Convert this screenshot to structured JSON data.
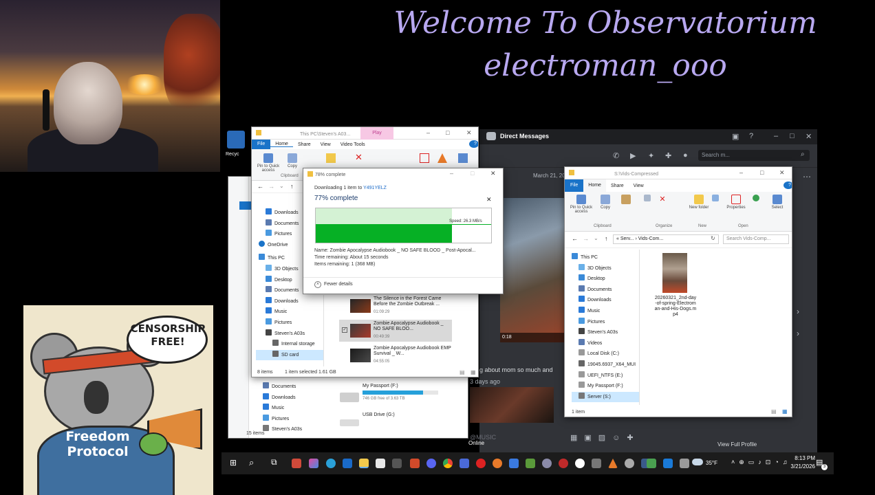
{
  "stream": {
    "line1": "Welcome To Observatorium",
    "line2": "electroman_ooo"
  },
  "koala": {
    "bubble_line1": "CENSORSHIP",
    "bubble_line2": "FREE!",
    "hoodie_line1": "Freedom",
    "hoodie_line2": "Protocol"
  },
  "discord": {
    "title": "Direct Messages",
    "search_placeholder": "Search m...",
    "date": "March 21, 2026",
    "video_time": "0:18",
    "message": "g about mom so  much and",
    "ago": "3 days ago",
    "input_label": "@MUSIC",
    "view_profile": "View Full Profile",
    "online": "Online"
  },
  "explorer_left": {
    "title": "This PC\\Steven's A03...",
    "context_tab": "Play",
    "tabs": [
      "File",
      "Home",
      "Share",
      "View",
      "Video Tools"
    ],
    "ribbon": {
      "pin": "Pin to Quick access",
      "copy": "Copy",
      "clipboard": "Clipboard"
    },
    "nav": [
      "Downloads",
      "Documents",
      "Pictures",
      "OneDrive",
      "This PC",
      "3D Objects",
      "Desktop",
      "Documents",
      "Downloads",
      "Music",
      "Pictures",
      "Steven's A03s",
      "Internal storage",
      "SD card"
    ],
    "files": [
      {
        "name": "The Silence in the Forest Came Before the Zombie Outbreak ...",
        "duration": "01:09:29",
        "selected": false
      },
      {
        "name": "Zombie Apocalypse Audiobook _ NO SAFE BLOO...",
        "duration": "00:49:39",
        "selected": true
      },
      {
        "name": "Zombie Apocalypse Audiobook EMP Survival _ W...",
        "duration": "04:55:05",
        "selected": false
      }
    ],
    "status_items": "8 items",
    "status_selected": "1 item selected  1.61 GB"
  },
  "explorer_back": {
    "nav": [
      "Documents",
      "Downloads",
      "Music",
      "Pictures",
      "Steven's A03s"
    ],
    "drives": [
      {
        "name": "My Passport (F:)",
        "free": "746 GB free of 3.63 TB",
        "used": 0.8
      },
      {
        "name": "USB Drive (G:)",
        "free": "",
        "used": 0
      }
    ],
    "status": "15 items"
  },
  "download": {
    "title": "78% complete",
    "downloading_prefix": "Downloading 1 item to ",
    "destination": "Y491YELZ",
    "percent_text": "77% complete",
    "speed": "Speed: 26.3 MB/s",
    "progress": 0.77,
    "name": "Name: Zombie Apocalypse Audiobook _ NO SAFE BLOOD _ Post-Apocal...",
    "time_remaining": "Time remaining: About 15 seconds",
    "items_remaining": "Items remaining: 1 (368 MB)",
    "fewer_details": "Fewer details"
  },
  "explorer_right": {
    "title": "S:\\Vids-Compressed",
    "tabs": [
      "File",
      "Home",
      "Share",
      "View"
    ],
    "ribbon": {
      "pin": "Pin to Quick access",
      "copy": "Copy",
      "paste": "Paste",
      "clipboard": "Clipboard",
      "organize": "Organize",
      "new_folder": "New folder",
      "new": "New",
      "properties": "Properties",
      "open": "Open",
      "select": "Select"
    },
    "path": "«  Serv...  ›  Vids-Com...",
    "search_placeholder": "Search Vids-Comp...",
    "nav": [
      "This PC",
      "3D Objects",
      "Desktop",
      "Documents",
      "Downloads",
      "Music",
      "Pictures",
      "Steven's A03s",
      "Videos",
      "Local Disk (C:)",
      "19045.6937_X64_MUI",
      "UEFI_NTFS (E:)",
      "My Passport (F:)",
      "Server (S:)"
    ],
    "file_name": "20260321_2nd-day-of-spring-Electroman-and-His-Dogs.mp4",
    "status": "1 item"
  },
  "taskbar": {
    "weather": "35°F",
    "time": "8:13 PM",
    "date": "3/21/2026",
    "notifications": "3"
  },
  "desktop": {
    "recycle": "Recyc"
  }
}
